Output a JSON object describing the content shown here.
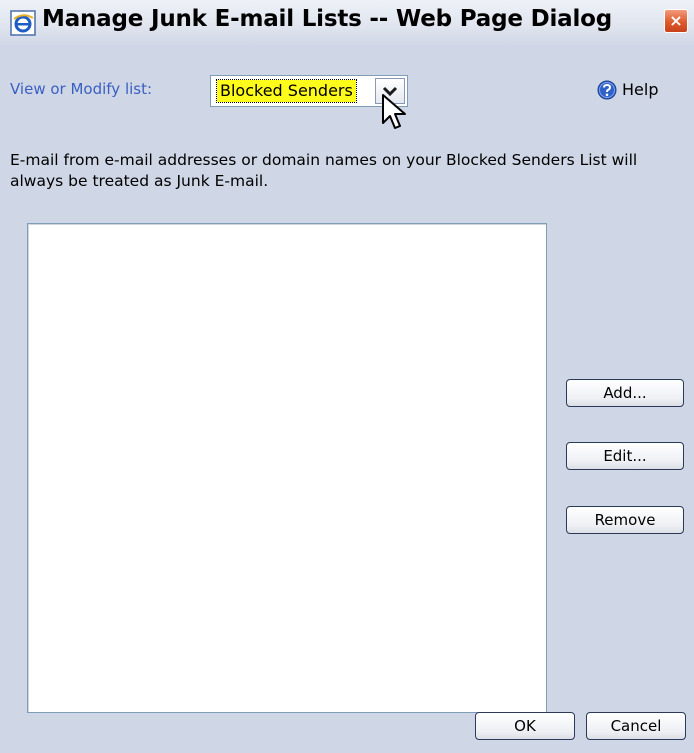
{
  "window": {
    "title": "Manage Junk E-mail Lists -- Web Page Dialog",
    "close_glyph": "×",
    "icons": {
      "app": "ie-page-icon",
      "close": "close-icon"
    }
  },
  "list_selector": {
    "label": "View or Modify list:",
    "selected": "Blocked Senders",
    "arrow_icon": "chevron-down-icon"
  },
  "help": {
    "label": "Help",
    "icon": "question-icon"
  },
  "description": "E-mail from e-mail addresses or domain names on your Blocked Senders List will always be treated as Junk E-mail.",
  "sender_list": {
    "items": []
  },
  "actions": {
    "add": "Add...",
    "edit": "Edit...",
    "remove": "Remove"
  },
  "footer": {
    "ok": "OK",
    "cancel": "Cancel"
  },
  "colors": {
    "dialog_background": "#cfd6e5",
    "label_blue": "#3a5fc2",
    "selection_highlight": "#fffb1a",
    "close_button": "#de5a2e",
    "help_icon": "#2f62c9"
  }
}
